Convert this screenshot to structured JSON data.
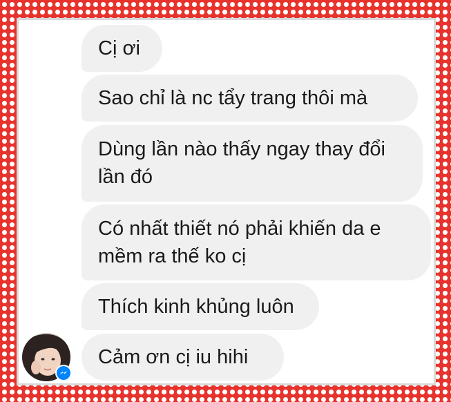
{
  "conversation": {
    "messages": [
      {
        "lines": [
          "Cị ơi"
        ]
      },
      {
        "lines": [
          "Sao chỉ là nc tẩy trang thôi mà"
        ]
      },
      {
        "lines": [
          "Dùng lần nào thấy ngay thay đổi",
          "lần đó"
        ]
      },
      {
        "lines": [
          "Có nhất thiết nó phải khiến da e",
          "mềm ra thế ko cị"
        ]
      },
      {
        "lines": [
          "Thích kinh khủng luôn"
        ]
      },
      {
        "lines": [
          "Cảm ơn cị iu hihi"
        ]
      }
    ]
  },
  "sender": {
    "avatar_icon": "user-avatar-photo",
    "badge_icon": "messenger-icon"
  },
  "colors": {
    "frame_red": "#e8322c",
    "frame_dots": "#ffffff",
    "bubble_bg": "#f1f0f0",
    "messenger_blue": "#0084ff"
  }
}
